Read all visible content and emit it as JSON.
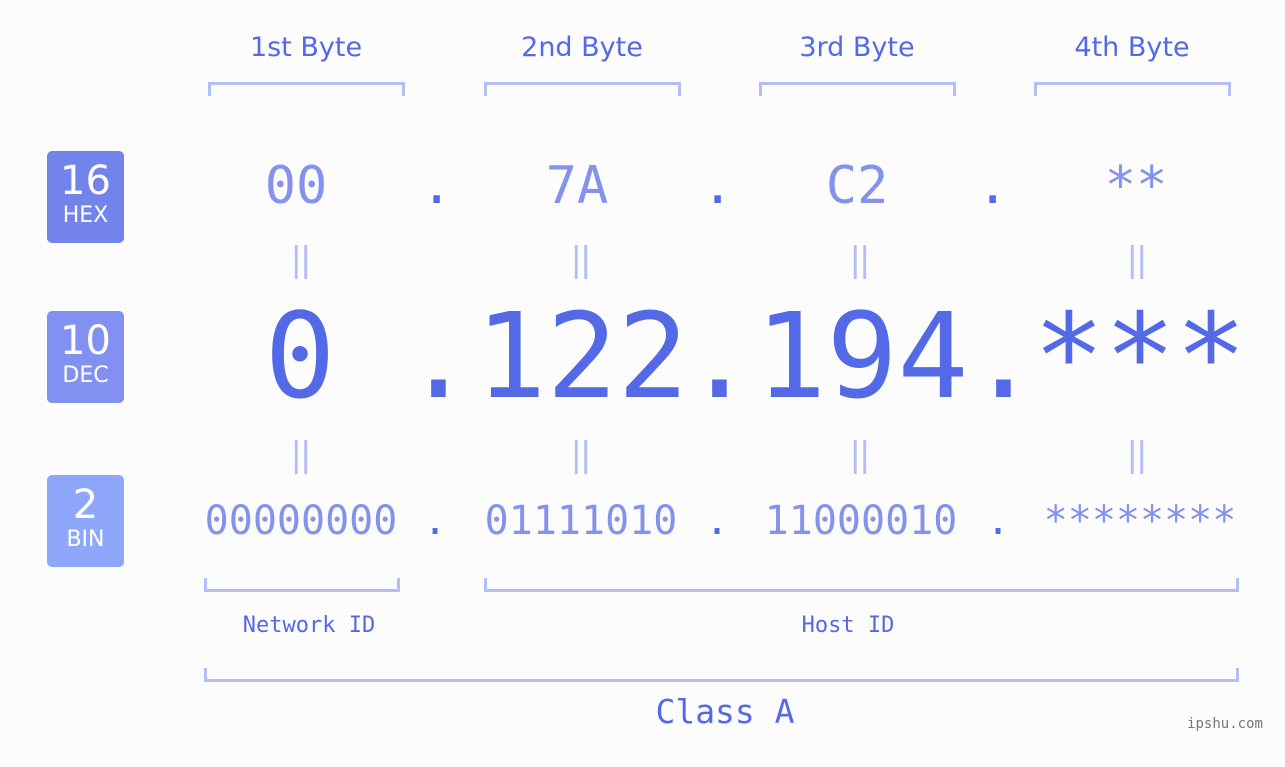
{
  "diagram": {
    "byte_headers": [
      "1st Byte",
      "2nd Byte",
      "3rd Byte",
      "4th Byte"
    ],
    "bases": [
      {
        "number": "16",
        "name": "HEX",
        "color": "#7383ec"
      },
      {
        "number": "10",
        "name": "DEC",
        "color": "#8291f1"
      },
      {
        "number": "2",
        "name": "BIN",
        "color": "#8fa7fb"
      }
    ],
    "hex": [
      "00",
      "7A",
      "C2",
      "**"
    ],
    "dec": [
      "0",
      "122",
      "194",
      "***"
    ],
    "bin": [
      "00000000",
      "01111010",
      "11000010",
      "********"
    ],
    "separator": ".",
    "equals_glyph": "||",
    "network_id_label": "Network ID",
    "host_id_label": "Host ID",
    "class_label": "Class A",
    "watermark": "ipshu.com"
  },
  "colors": {
    "accent": "#5469e6",
    "light_accent": "#8592ed",
    "bracket": "#b3bdf7",
    "background": "#fbfcfb"
  }
}
